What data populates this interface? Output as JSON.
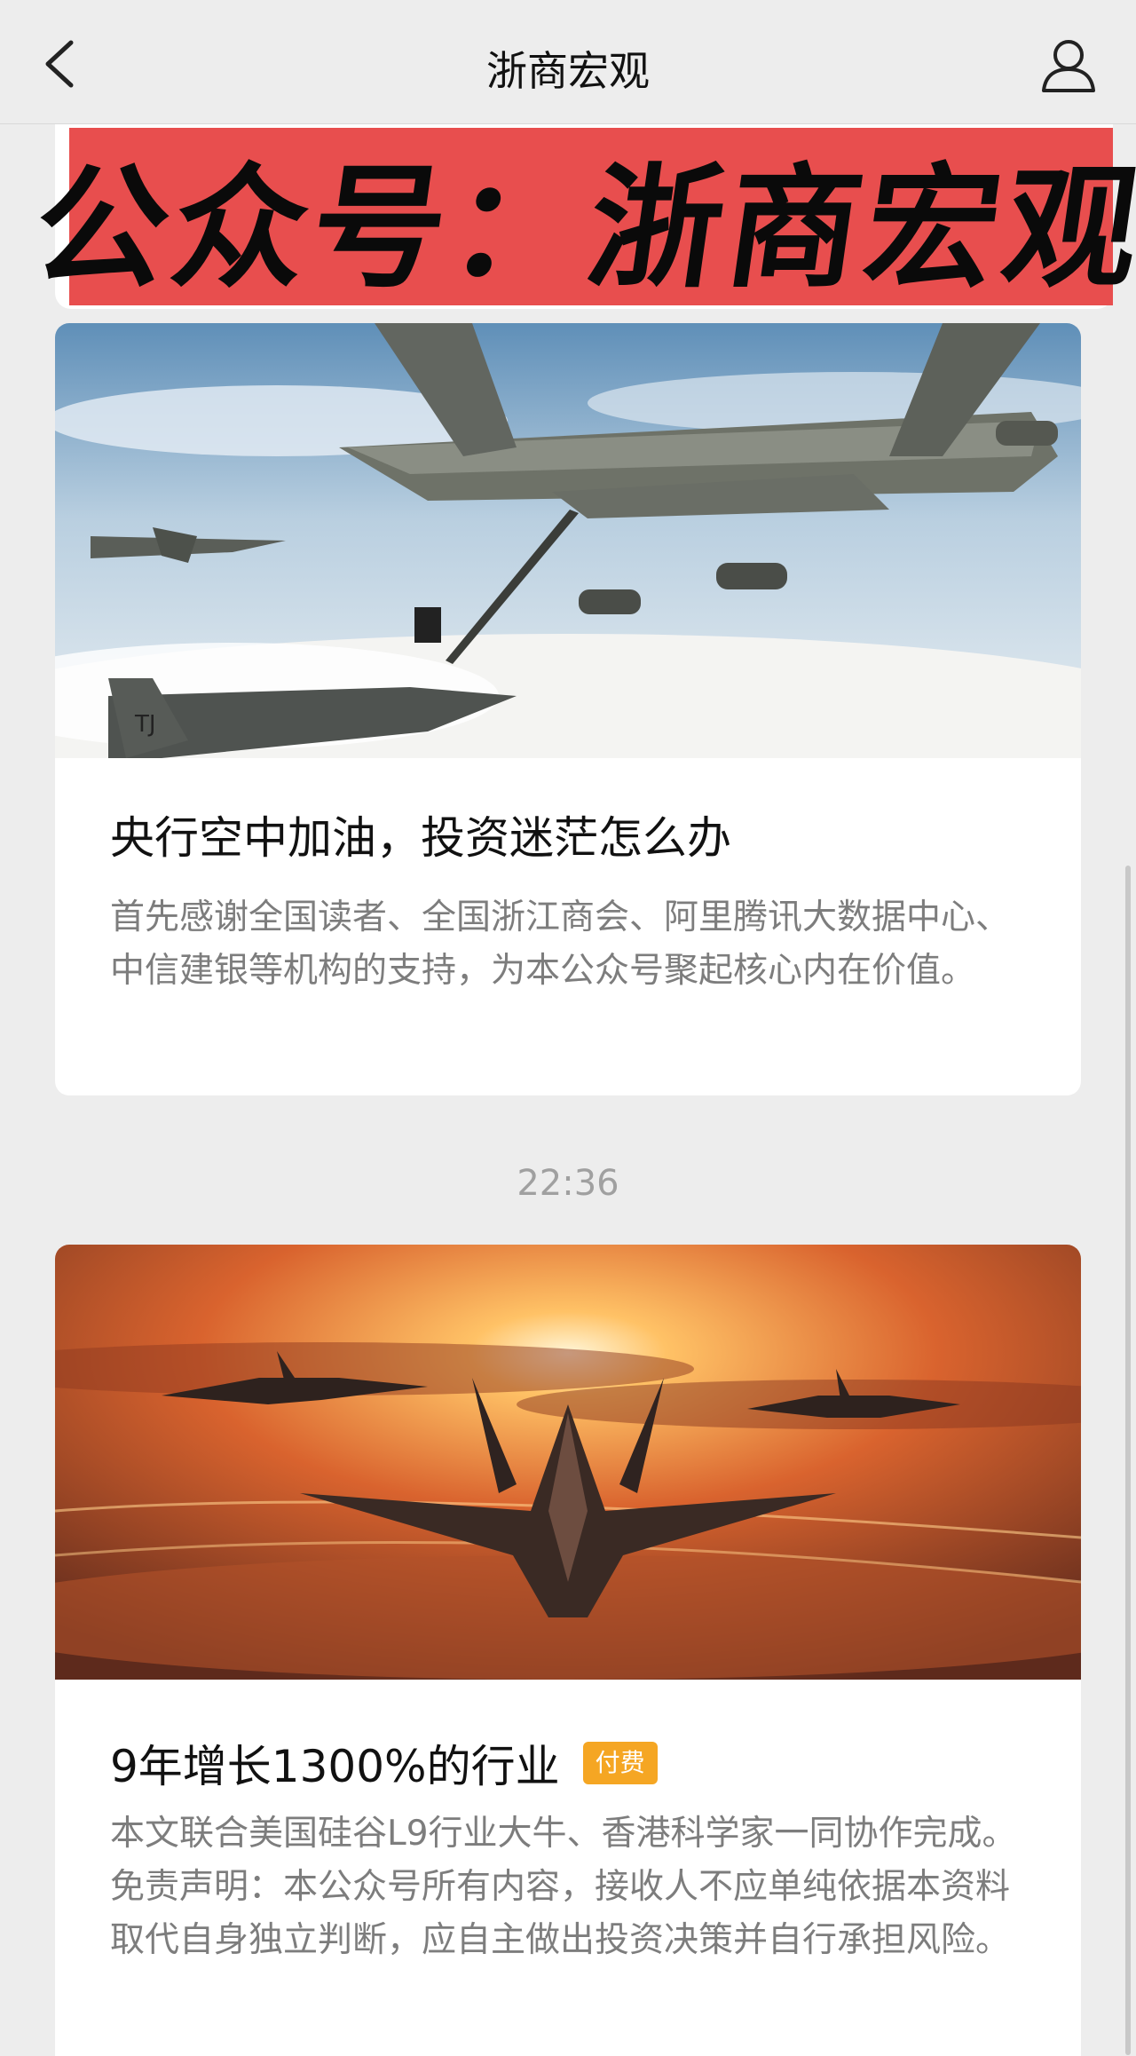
{
  "header": {
    "title": "浙商宏观",
    "back_icon": "chevron-left-icon",
    "profile_icon": "person-icon"
  },
  "banner": {
    "text": "公众号：浙商宏观",
    "background": "#e84e4e"
  },
  "articles": [
    {
      "title": "央行空中加油，投资迷茫怎么办",
      "summary": "首先感谢全国读者、全国浙江商会、阿里腾讯大数据中心、中信建银等机构的支持，为本公众号聚起核心内在价值。",
      "image": "aerial-refueling-photo"
    },
    {
      "title": "9年增长1300%的行业",
      "badge": "付费",
      "summary": "本文联合美国硅谷L9行业大牛、香港科学家一同协作完成。免责声明：本公众号所有内容，接收人不应单纯依据本资料取代自身独立判断，应自主做出投资决策并自行承担风险。",
      "image": "fighter-jets-sunset-photo"
    }
  ],
  "timestamp": "22:36",
  "colors": {
    "badge": "#f5a623",
    "background": "#ededed"
  }
}
